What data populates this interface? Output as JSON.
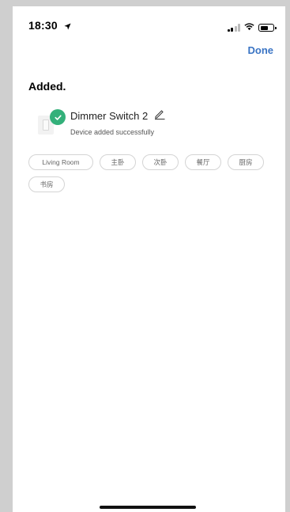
{
  "status_bar": {
    "time": "18:30"
  },
  "header": {
    "done_label": "Done"
  },
  "page": {
    "title": "Added."
  },
  "device": {
    "name": "Dimmer Switch 2",
    "status": "Device added successfully"
  },
  "rooms": [
    "Living Room",
    "主卧",
    "次卧",
    "餐厅",
    "厨房",
    "书房"
  ],
  "colors": {
    "accent": "#3a74c4",
    "success": "#33b07a"
  }
}
